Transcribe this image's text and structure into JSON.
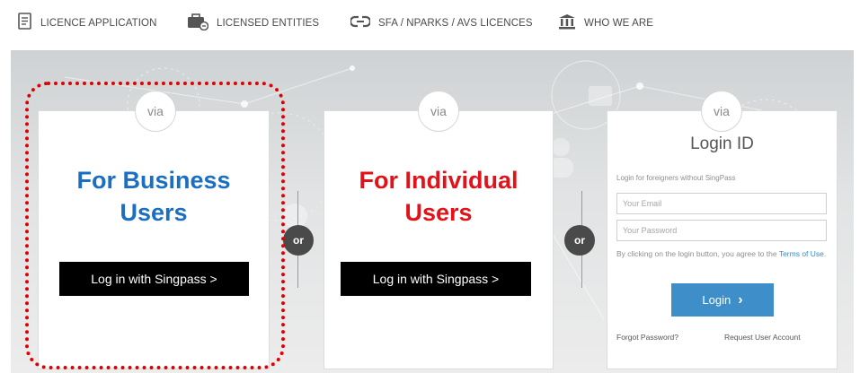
{
  "nav": {
    "items": [
      {
        "label": "LICENCE APPLICATION",
        "icon": "document-icon"
      },
      {
        "label": "LICENSED ENTITIES",
        "icon": "briefcase-icon"
      },
      {
        "label": "SFA / NPARKS / AVS LICENCES",
        "icon": "link-icon"
      },
      {
        "label": "WHO WE ARE",
        "icon": "building-icon"
      }
    ]
  },
  "cards": {
    "business": {
      "via": "via",
      "title_line1": "For Business",
      "title_line2": "Users",
      "button": "Log in with Singpass >",
      "title_color": "#1c6fc0"
    },
    "individual": {
      "via": "via",
      "title_line1": "For Individual",
      "title_line2": "Users",
      "button": "Log in with Singpass >",
      "title_color": "#e0131a"
    },
    "login_id": {
      "via": "via",
      "title": "Login ID",
      "subtitle": "Login for foreigners without SingPass",
      "email_placeholder": "Your Email",
      "password_placeholder": "Your Password",
      "terms_prefix": "By clicking on the login button, you agree to the ",
      "terms_link": "Terms of Use",
      "terms_suffix": ".",
      "login_button": "Login",
      "forgot_password": "Forgot Password?",
      "request_account": "Request User Account"
    }
  },
  "separators": {
    "or1": "or",
    "or2": "or"
  },
  "colors": {
    "login_button": "#3d8ec9",
    "annotation": "#e00000",
    "singpass_button": "#000000"
  }
}
